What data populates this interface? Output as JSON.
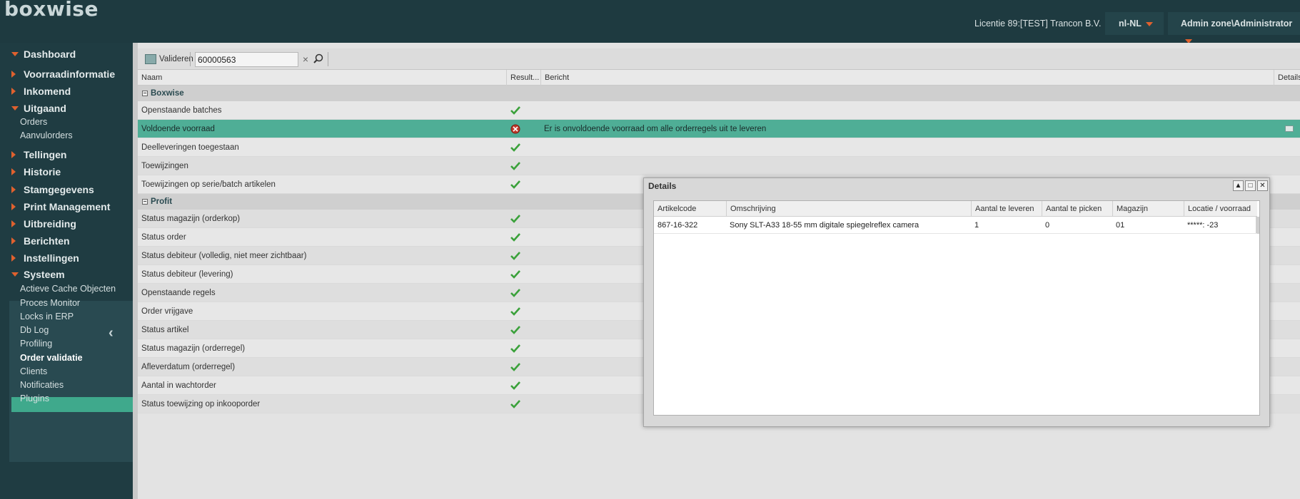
{
  "app": {
    "logo": "boxwise",
    "license": "Licentie 89:[TEST] Trancon B.V.",
    "language": "nl-NL",
    "user": "Admin zone\\Administrator"
  },
  "sidebar": {
    "sections": [
      {
        "label": "Dashboard",
        "expanded": true
      },
      {
        "label": "Voorraadinformatie",
        "expanded": false
      },
      {
        "label": "Inkomend",
        "expanded": false
      },
      {
        "label": "Uitgaand",
        "expanded": true
      },
      {
        "label": "Tellingen",
        "expanded": false
      },
      {
        "label": "Historie",
        "expanded": false
      },
      {
        "label": "Stamgegevens",
        "expanded": false
      },
      {
        "label": "Print Management",
        "expanded": false
      },
      {
        "label": "Uitbreiding",
        "expanded": false
      },
      {
        "label": "Berichten",
        "expanded": false
      },
      {
        "label": "Instellingen",
        "expanded": false
      },
      {
        "label": "Systeem",
        "expanded": true
      }
    ],
    "uitgaand_items": [
      "Orders",
      "Aanvulorders"
    ],
    "systeem_items": [
      "Actieve Cache Objecten",
      "Proces Monitor",
      "Locks in ERP",
      "Db Log",
      "Profiling",
      "Order validatie",
      "Clients",
      "Notificaties",
      "Plugins"
    ],
    "selected": "Order validatie"
  },
  "toolbar": {
    "validate_label": "Valideren",
    "search_value": "60000563",
    "clear_icon": "clear-icon",
    "search_icon": "search-icon"
  },
  "grid": {
    "headers": {
      "name": "Naam",
      "result": "Result...",
      "message": "Bericht",
      "details": "Details"
    },
    "groups": [
      {
        "label": "Boxwise",
        "rows": [
          {
            "name": "Openstaande batches",
            "result": "ok",
            "message": ""
          },
          {
            "name": "Voldoende voorraad",
            "result": "error",
            "message": "Er is onvoldoende voorraad om alle orderregels uit te leveren",
            "has_details": true
          },
          {
            "name": "Deelleveringen toegestaan",
            "result": "ok",
            "message": ""
          },
          {
            "name": "Toewijzingen",
            "result": "ok",
            "message": ""
          },
          {
            "name": "Toewijzingen op serie/batch artikelen",
            "result": "ok",
            "message": ""
          }
        ]
      },
      {
        "label": "Profit",
        "rows": [
          {
            "name": "Status magazijn (orderkop)",
            "result": "ok",
            "message": ""
          },
          {
            "name": "Status order",
            "result": "ok",
            "message": ""
          },
          {
            "name": "Status debiteur (volledig, niet meer zichtbaar)",
            "result": "ok",
            "message": ""
          },
          {
            "name": "Status debiteur (levering)",
            "result": "ok",
            "message": ""
          },
          {
            "name": "Openstaande regels",
            "result": "ok",
            "message": ""
          },
          {
            "name": "Order vrijgave",
            "result": "ok",
            "message": ""
          },
          {
            "name": "Status artikel",
            "result": "ok",
            "message": ""
          },
          {
            "name": "Status magazijn (orderregel)",
            "result": "ok",
            "message": ""
          },
          {
            "name": "Afleverdatum (orderregel)",
            "result": "ok",
            "message": ""
          },
          {
            "name": "Aantal in wachtorder",
            "result": "ok",
            "message": ""
          },
          {
            "name": "Status toewijzing op inkooporder",
            "result": "ok",
            "message": ""
          }
        ]
      }
    ]
  },
  "dialog": {
    "title": "Details",
    "headers": {
      "code": "Artikelcode",
      "desc": "Omschrijving",
      "deliver": "Aantal te leveren",
      "pick": "Aantal te picken",
      "warehouse": "Magazijn",
      "location": "Locatie / voorraad"
    },
    "row": {
      "code": "867-16-322",
      "desc": "Sony SLT-A33 18-55 mm digitale spiegelreflex camera",
      "deliver": "1",
      "pick": "0",
      "warehouse": "01",
      "location": "*****: -23"
    }
  },
  "colors": {
    "accent": "#e0612e",
    "selected": "#3fa98c",
    "ok": "#3aa13a",
    "error": "#c0392b"
  }
}
